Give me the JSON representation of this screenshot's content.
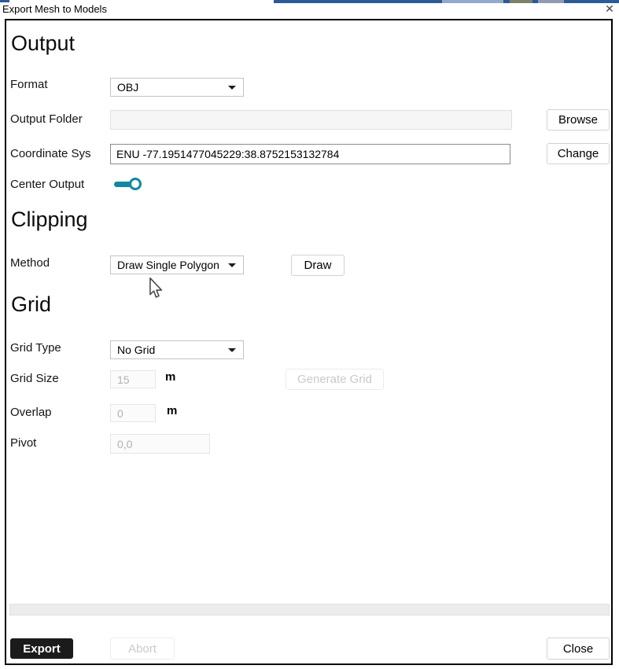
{
  "window": {
    "title": "Export Mesh to Models",
    "close_glyph": "✕"
  },
  "colors": {
    "accent_teal": "#1287a2",
    "app_edge_blue": "#2b5a97",
    "export_button_bg": "#1b1b1b"
  },
  "output_section": {
    "heading": "Output",
    "format": {
      "label": "Format",
      "value": "OBJ"
    },
    "output_folder": {
      "label": "Output Folder",
      "value": "",
      "browse_label": "Browse"
    },
    "coordinate_sys": {
      "label": "Coordinate Sys",
      "value": "ENU -77.1951477045229:38.8752153132784",
      "change_label": "Change"
    },
    "center_output": {
      "label": "Center Output",
      "state": "on"
    }
  },
  "clipping_section": {
    "heading": "Clipping",
    "method": {
      "label": "Method",
      "value": "Draw Single Polygon"
    },
    "draw_label": "Draw"
  },
  "grid_section": {
    "heading": "Grid",
    "grid_type": {
      "label": "Grid Type",
      "value": "No Grid"
    },
    "grid_size": {
      "label": "Grid Size",
      "value": "15",
      "unit": "m"
    },
    "generate_grid_label": "Generate Grid",
    "overlap": {
      "label": "Overlap",
      "value": "0",
      "unit": "m"
    },
    "pivot": {
      "label": "Pivot",
      "value": "0,0"
    }
  },
  "footer": {
    "export_label": "Export",
    "abort_label": "Abort",
    "close_label": "Close"
  }
}
